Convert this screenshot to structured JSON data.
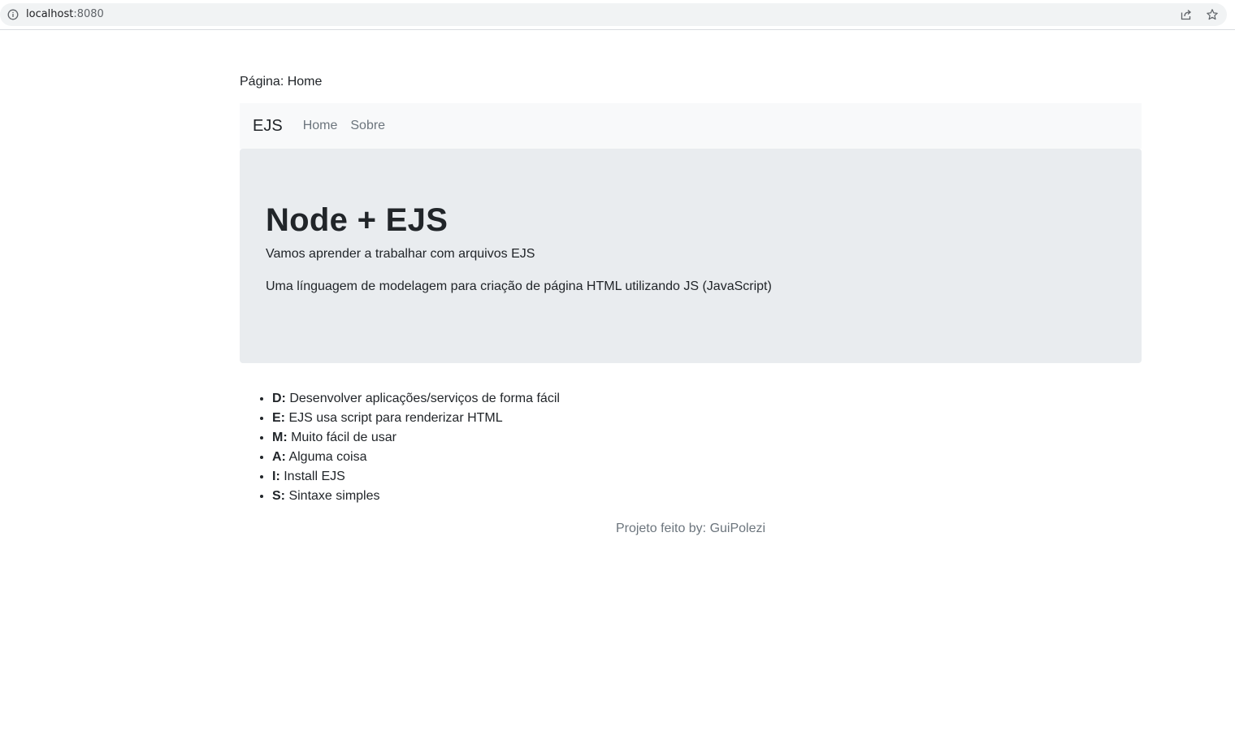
{
  "browser": {
    "url_host": "localhost",
    "url_port": ":8080",
    "icons": {
      "info": "info-icon",
      "share": "share-icon",
      "bookmark": "star-icon"
    }
  },
  "page": {
    "label": "Página: Home"
  },
  "navbar": {
    "brand": "EJS",
    "links": [
      {
        "label": "Home"
      },
      {
        "label": "Sobre"
      }
    ]
  },
  "jumbotron": {
    "title": "Node + EJS",
    "lead": "Vamos aprender a trabalhar com arquivos EJS",
    "text": "Uma línguagem de modelagem para criação de página HTML utilizando JS (JavaScript)"
  },
  "features": [
    {
      "key": "D:",
      "text": " Desenvolver aplicações/serviços de forma fácil"
    },
    {
      "key": "E:",
      "text": " EJS usa script para renderizar HTML"
    },
    {
      "key": "M:",
      "text": " Muito fácil de usar"
    },
    {
      "key": "A:",
      "text": " Alguma coisa"
    },
    {
      "key": "I:",
      "text": " Install EJS"
    },
    {
      "key": "S:",
      "text": " Sintaxe simples"
    }
  ],
  "footer": {
    "text": "Projeto feito by: GuiPolezi"
  },
  "colors": {
    "navbar_bg": "#f8f9fa",
    "jumbotron_bg": "#e9ecef",
    "muted_text": "#6c757d",
    "body_text": "#212529"
  }
}
